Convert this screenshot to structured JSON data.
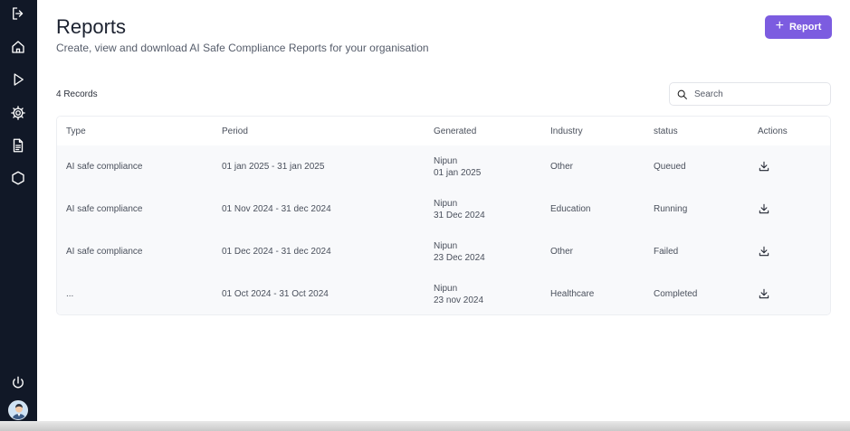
{
  "sidebar": {
    "icons": [
      "logout-icon",
      "home-icon",
      "play-icon",
      "gear-icon",
      "document-icon",
      "hexagon-icon",
      "power-icon"
    ]
  },
  "header": {
    "title": "Reports",
    "subtitle": "Create, view and download AI Safe Compliance Reports for your organisation",
    "add_button_label": "Report",
    "accent_color": "#7c5ce0"
  },
  "toolbar": {
    "records_label": "4 Records",
    "search_placeholder": "Search"
  },
  "table": {
    "columns": [
      "Type",
      "Period",
      "Generated",
      "Industry",
      "status",
      "Actions"
    ],
    "rows": [
      {
        "type": "AI safe compliance",
        "period": "01 jan 2025 - 31 jan 2025",
        "generated_by": "Nipun",
        "generated_date": "01 jan 2025",
        "industry": "Other",
        "status": "Queued"
      },
      {
        "type": "AI safe compliance",
        "period": "01 Nov 2024 - 31 dec 2024",
        "generated_by": "Nipun",
        "generated_date": "31 Dec 2024",
        "industry": "Education",
        "status": "Running"
      },
      {
        "type": "AI safe compliance",
        "period": "01 Dec 2024 - 31 dec 2024",
        "generated_by": "Nipun",
        "generated_date": "23 Dec 2024",
        "industry": "Other",
        "status": "Failed"
      },
      {
        "type": "...",
        "period": "01 Oct 2024 - 31 Oct 2024",
        "generated_by": "Nipun",
        "generated_date": "23 nov 2024",
        "industry": "Healthcare",
        "status": "Completed"
      }
    ]
  }
}
